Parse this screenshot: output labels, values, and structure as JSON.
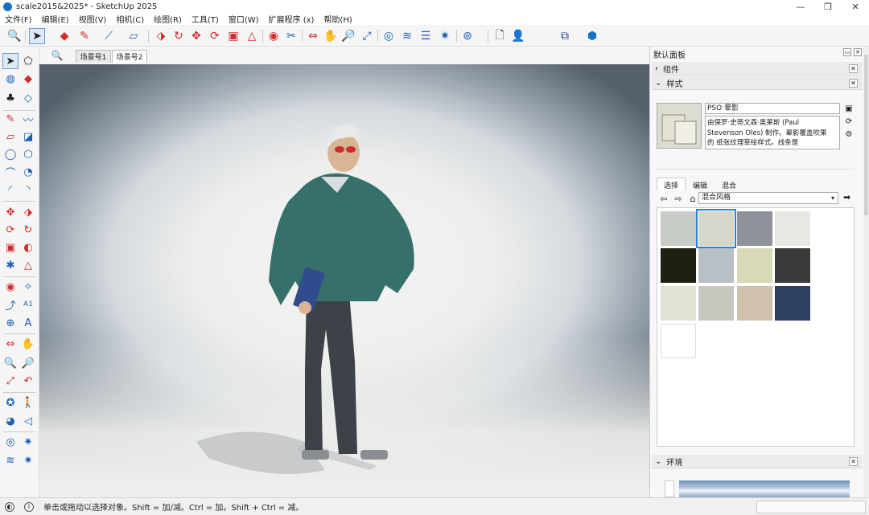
{
  "window": {
    "title": "scale2015&2025* - SketchUp 2025"
  },
  "menu": [
    "文件(F)",
    "编辑(E)",
    "视图(V)",
    "相机(C)",
    "绘图(R)",
    "工具(T)",
    "窗口(W)",
    "扩展程序 (x)",
    "帮助(H)"
  ],
  "scene_tabs": [
    "场景号1",
    "场景号2"
  ],
  "panel": {
    "title": "默认面板",
    "components_label": "组件",
    "styles_label": "样式",
    "style_name": "PSO 晕影",
    "style_desc": "由保罗·史蒂文森·奥莱斯 (Paul Stevenson Oles) 制作。晕影覆盖吹果的 纸张纹理草绘样式。线条是 SketchUp 曲",
    "tabs": [
      "选择",
      "编辑",
      "混合"
    ],
    "collection": "混合风格",
    "environment_label": "环境"
  },
  "status": {
    "text": "单击或拖动以选择对象。Shift = 加/减。Ctrl = 加。Shift + Ctrl = 减。"
  },
  "icons": {
    "toolbar": [
      "zoom-icon",
      "select-icon",
      "eraser-icon",
      "pencil-icon",
      "line-icon",
      "rectangle-icon",
      "push-pull-icon",
      "follow-me-icon",
      "move-icon",
      "rotate-icon",
      "offset-icon",
      "section-icon",
      "paint-icon",
      "tape-icon",
      "orbit-icon",
      "pan-icon",
      "zoom-extents-icon",
      "layers-icon",
      "tag-icon",
      "outliner-icon",
      "scenes-icon",
      "document-icon",
      "user-icon",
      "extension-warehouse-icon",
      "sketchup-logo-icon"
    ],
    "left": [
      "select-icon",
      "lasso-icon",
      "paint-bucket-icon",
      "eraser-icon",
      "component-icon",
      "tag-eraser-icon",
      "pencil-icon",
      "freehand-icon",
      "rectangle-icon",
      "rotated-rectangle-icon",
      "circle-icon",
      "polygon-icon",
      "arc-icon",
      "pie-icon",
      "3pt-arc-icon",
      "2pt-arc-icon",
      "move-icon",
      "push-pull-icon",
      "rotate-icon",
      "follow-me-icon",
      "scale-icon",
      "offset-icon",
      "solid-icon",
      "section-plane-icon",
      "tape-measure-icon",
      "protractor-icon",
      "dimension-icon",
      "text-icon",
      "axes-icon",
      "3d-text-icon",
      "orbit-icon",
      "pan-icon",
      "zoom-icon",
      "zoom-window-icon",
      "zoom-extents-icon",
      "previous-view-icon",
      "position-camera-icon",
      "walk-icon",
      "look-around-icon",
      "section-display-icon",
      "sandbox-icon",
      "warehouse-icon",
      "layers-icon",
      "outliner-icon"
    ]
  },
  "colors": {
    "accent": "#2f7fd6",
    "toolbar_red": "#d12b2b",
    "brand": "#1673c4"
  }
}
